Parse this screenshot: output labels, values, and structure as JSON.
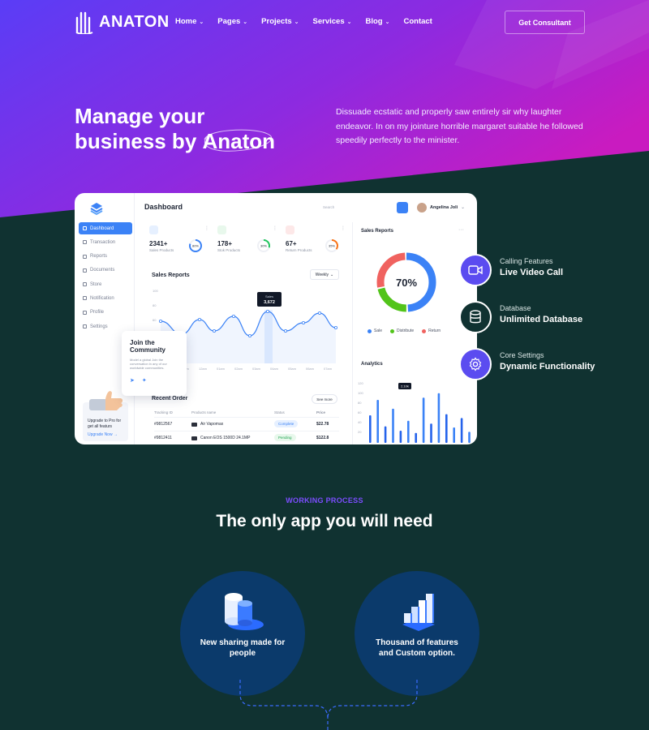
{
  "nav": {
    "logo_text": "ANATON",
    "items": [
      {
        "label": "Home",
        "dropdown": true
      },
      {
        "label": "Pages",
        "dropdown": true
      },
      {
        "label": "Projects",
        "dropdown": true
      },
      {
        "label": "Services",
        "dropdown": true
      },
      {
        "label": "Blog",
        "dropdown": true
      },
      {
        "label": "Contact",
        "dropdown": false
      }
    ],
    "cta_label": "Get Consultant"
  },
  "hero": {
    "headline_line1": "Manage your",
    "headline_line2_prefix": "business by ",
    "headline_accent": "Anaton",
    "description": "Dissuade ecstatic and properly saw entirely sir why laughter endeavor. In on my jointure horrible margaret suitable he followed speedily perfectly to the minister.",
    "gradient_start": "#5b3cf5",
    "gradient_end": "#c01bc4"
  },
  "dashboard": {
    "title": "Dashboard",
    "search_placeholder": "Search",
    "user_name": "Angelina Joli",
    "sidebar": [
      {
        "label": "Dashboard",
        "active": true
      },
      {
        "label": "Transaction"
      },
      {
        "label": "Reports"
      },
      {
        "label": "Documents"
      },
      {
        "label": "Store"
      },
      {
        "label": "Notification"
      },
      {
        "label": "Profile"
      },
      {
        "label": "Settings"
      }
    ],
    "upgrade_text": "Upgrade to Pro for get all featurs",
    "upgrade_link": "Upgrade Now",
    "stats": [
      {
        "value": "2341+",
        "label": "Sales Products",
        "percent": "80%",
        "fraction": 0.8,
        "color": "#3b82f6"
      },
      {
        "value": "178+",
        "label": "Stok Products",
        "percent": "30%",
        "fraction": 0.3,
        "color": "#22c55e"
      },
      {
        "value": "67+",
        "label": "Return Products",
        "percent": "35%",
        "fraction": 0.35,
        "color": "#f97316"
      }
    ],
    "sales_reports": {
      "title": "Sales Reports",
      "filter": "Weekly",
      "tooltip_label": "Sales",
      "tooltip_value": "3,672",
      "y_ticks": [
        "100",
        "80",
        "60",
        "40",
        "20"
      ],
      "x_ticks": [
        "10am",
        "11am",
        "12am",
        "01am",
        "02am",
        "03am",
        "04am",
        "05am",
        "06am",
        "07am"
      ]
    },
    "community": {
      "title": "Join the Community",
      "text": "Model a global Join the conversation in any of our worldwide communities."
    },
    "recent_order": {
      "title": "Recent Order",
      "see_more": "See more",
      "headers": [
        "Tracking ID",
        "Products name",
        "Status",
        "Price"
      ],
      "rows": [
        {
          "id": "#9812567",
          "product": "Air Vapomax",
          "status": "Complete",
          "status_type": "complete",
          "price": "$22.78"
        },
        {
          "id": "#9812411",
          "product": "Canon EOS 1500D 24.1MP",
          "status": "Pending",
          "status_type": "pending",
          "price": "$122.8"
        }
      ]
    },
    "donut": {
      "title": "Sales Reports",
      "value": "70%",
      "segments": [
        {
          "name": "Sale",
          "fraction": 0.5,
          "color": "#3b82f6"
        },
        {
          "name": "Distribute",
          "fraction": 0.22,
          "color": "#52c41a"
        },
        {
          "name": "Return",
          "fraction": 0.28,
          "color": "#f0625f"
        }
      ]
    },
    "analytics": {
      "title": "Analytics",
      "y_ticks": [
        "120",
        "100",
        "80",
        "60",
        "40",
        "20"
      ],
      "tooltip": "2.10k"
    }
  },
  "features": [
    {
      "sub": "Calling Features",
      "main": "Live Video Call",
      "icon": "video-icon",
      "bg": "#5b4cf0"
    },
    {
      "sub": "Database",
      "main": "Unlimited Database",
      "icon": "database-icon",
      "bg": "#103231"
    },
    {
      "sub": "Core Settings",
      "main": "Dynamic Functionality",
      "icon": "gear-icon",
      "bg": "#5b4cf0"
    }
  ],
  "working_process": {
    "tag": "WORKING PROCESS",
    "title": "The only app you will need",
    "steps": [
      {
        "label": "New sharing made for people",
        "icon": "cylinders-icon"
      },
      {
        "label": "Thousand of features and Custom option.",
        "icon": "cubes-bar-icon"
      }
    ]
  }
}
